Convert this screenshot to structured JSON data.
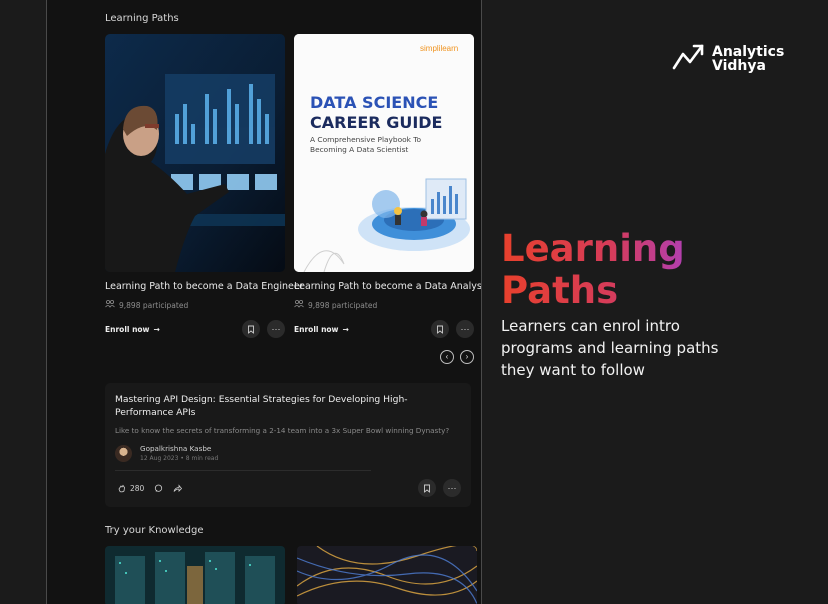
{
  "phone": {
    "learning_paths_title": "Learning Paths",
    "cards": [
      {
        "title": "Learning Path to become a Data Engineer",
        "participated": "9,898 participated",
        "enroll_label": "Enroll now"
      },
      {
        "title": "Learning Path to become a Data Analyst",
        "participated": "9,898 participated",
        "enroll_label": "Enroll now"
      }
    ],
    "book": {
      "brand": "simplilearn",
      "title_line1": "DATA SCIENCE",
      "title_line2": "CAREER GUIDE",
      "subtitle_line1": "A Comprehensive Playbook To",
      "subtitle_line2": "Becoming A Data Scientist"
    },
    "article": {
      "title": "Mastering API Design: Essential Strategies for Developing High-Performance APIs",
      "description": "Like to know the secrets of transforming a 2-14 team into a 3x Super Bowl winning Dynasty?",
      "author": "Gopalkrishna Kasbe",
      "date": "12 Aug 2023 • 8 min read",
      "likes": "280"
    },
    "knowledge_title": "Try your Knowledge"
  },
  "brand": {
    "line1": "Analytics",
    "line2": "Vidhya"
  },
  "hero": {
    "headline_line1": "Learning",
    "headline_line2": "Paths",
    "subtext": "Learners can enrol intro programs and learning paths they want to follow"
  },
  "colors": {
    "background": "#1b1b1b",
    "panel": "#121212",
    "accent_start": "#e8402c",
    "accent_end": "#b23fb0",
    "book_title": "#2b52b5"
  },
  "icons": [
    "participants-icon",
    "arrow-right-icon",
    "bookmark-icon",
    "more-icon",
    "chevron-left-icon",
    "chevron-right-icon",
    "clap-icon",
    "comment-icon",
    "share-icon",
    "analytics-vidhya-logo-icon"
  ]
}
